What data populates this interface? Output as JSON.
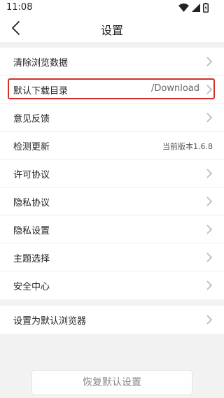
{
  "status_bar": {
    "time": "11:08",
    "icons": [
      "wifi-icon",
      "signal-icon",
      "battery-icon"
    ]
  },
  "header": {
    "title": "设置",
    "back_icon": "back-arrow-icon"
  },
  "settings_group_1": [
    {
      "label": "清除浏览数据",
      "value": ""
    },
    {
      "label": "默认下载目录",
      "value": "/Download"
    },
    {
      "label": "意见反馈",
      "value": ""
    },
    {
      "label": "检测更新",
      "value": "当前版本1.6.8"
    },
    {
      "label": "许可协议",
      "value": ""
    },
    {
      "label": "隐私协议",
      "value": ""
    },
    {
      "label": "隐私设置",
      "value": ""
    },
    {
      "label": "主题选择",
      "value": ""
    },
    {
      "label": "安全中心",
      "value": ""
    }
  ],
  "settings_group_2": [
    {
      "label": "设置为默认浏览器",
      "value": ""
    }
  ],
  "reset_button": {
    "label": "恢复默认设置"
  },
  "colors": {
    "highlight": "#d32f2f",
    "background": "#f2f2f2",
    "chevron": "#b8b8b8"
  }
}
